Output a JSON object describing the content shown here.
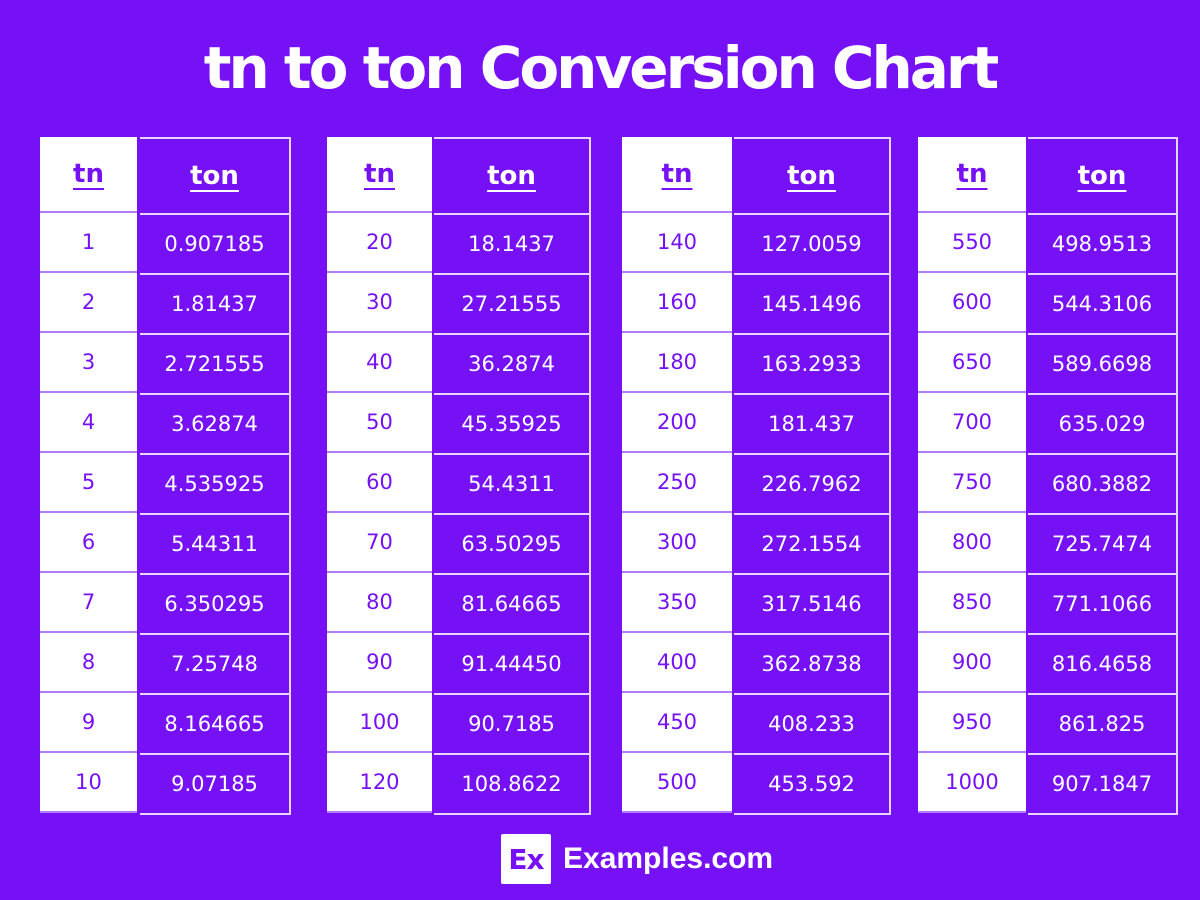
{
  "title": "tn to ton Conversion Chart",
  "colors": {
    "background": "#7610F5",
    "cell_light": "#FFFFFF",
    "text_light": "#FFFFFF",
    "text_accent": "#7610F5"
  },
  "footer": {
    "logo_text": "Ex",
    "brand": "Examples.com"
  },
  "chart_data": {
    "type": "table",
    "title": "tn to ton Conversion Chart",
    "columns": [
      "tn",
      "ton"
    ],
    "tables": [
      {
        "header": [
          "tn",
          "ton"
        ],
        "rows": [
          [
            "1",
            "0.907185"
          ],
          [
            "2",
            "1.81437"
          ],
          [
            "3",
            "2.721555"
          ],
          [
            "4",
            "3.62874"
          ],
          [
            "5",
            "4.535925"
          ],
          [
            "6",
            "5.44311"
          ],
          [
            "7",
            "6.350295"
          ],
          [
            "8",
            "7.25748"
          ],
          [
            "9",
            "8.164665"
          ],
          [
            "10",
            "9.07185"
          ]
        ]
      },
      {
        "header": [
          "tn",
          "ton"
        ],
        "rows": [
          [
            "20",
            "18.1437"
          ],
          [
            "30",
            "27.21555"
          ],
          [
            "40",
            "36.2874"
          ],
          [
            "50",
            "45.35925"
          ],
          [
            "60",
            "54.4311"
          ],
          [
            "70",
            "63.50295"
          ],
          [
            "80",
            "81.64665"
          ],
          [
            "90",
            "91.44450"
          ],
          [
            "100",
            "90.7185"
          ],
          [
            "120",
            "108.8622"
          ]
        ]
      },
      {
        "header": [
          "tn",
          "ton"
        ],
        "rows": [
          [
            "140",
            "127.0059"
          ],
          [
            "160",
            "145.1496"
          ],
          [
            "180",
            "163.2933"
          ],
          [
            "200",
            "181.437"
          ],
          [
            "250",
            "226.7962"
          ],
          [
            "300",
            "272.1554"
          ],
          [
            "350",
            "317.5146"
          ],
          [
            "400",
            "362.8738"
          ],
          [
            "450",
            "408.233"
          ],
          [
            "500",
            "453.592"
          ]
        ]
      },
      {
        "header": [
          "tn",
          "ton"
        ],
        "rows": [
          [
            "550",
            "498.9513"
          ],
          [
            "600",
            "544.3106"
          ],
          [
            "650",
            "589.6698"
          ],
          [
            "700",
            "635.029"
          ],
          [
            "750",
            "680.3882"
          ],
          [
            "800",
            "725.7474"
          ],
          [
            "850",
            "771.1066"
          ],
          [
            "900",
            "816.4658"
          ],
          [
            "950",
            "861.825"
          ],
          [
            "1000",
            "907.1847"
          ]
        ]
      }
    ]
  }
}
